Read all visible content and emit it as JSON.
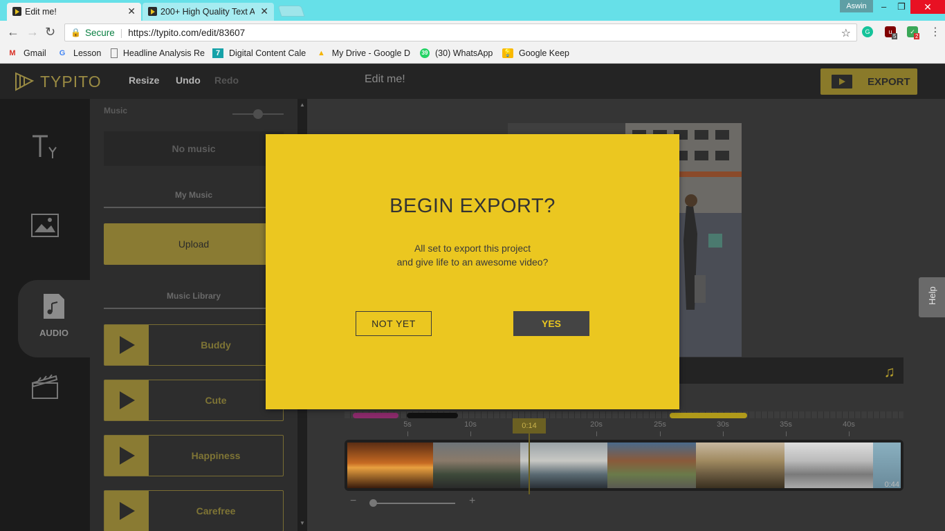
{
  "browser": {
    "tabs": [
      {
        "title": "Edit me!",
        "active": true
      },
      {
        "title": "200+ High Quality Text A",
        "active": false
      }
    ],
    "user": "Aswin",
    "secure_label": "Secure",
    "url": "https://typito.com/edit/83607",
    "ext_badges": {
      "ublock": "5",
      "green": "2"
    },
    "bookmarks": [
      {
        "label": "Gmail",
        "icon": "gmail-icon"
      },
      {
        "label": "Lesson",
        "icon": "google-icon"
      },
      {
        "label": "Headline Analysis Re",
        "icon": "page-icon"
      },
      {
        "label": "Digital Content Cale",
        "icon": "calendar-icon"
      },
      {
        "label": "My Drive - Google D",
        "icon": "drive-icon"
      },
      {
        "label": "(30) WhatsApp",
        "icon": "whatsapp-icon"
      },
      {
        "label": "Google Keep",
        "icon": "keep-icon"
      }
    ]
  },
  "app": {
    "logo": "TYPITO",
    "resize": "Resize",
    "undo": "Undo",
    "redo": "Redo",
    "project_title": "Edit me!",
    "export": "EXPORT",
    "accent": "#ebc720"
  },
  "rail": {
    "active_label": "AUDIO",
    "tabs": [
      "text-icon",
      "image-icon",
      "audio-icon",
      "clapper-icon"
    ]
  },
  "music_panel": {
    "music_label": "Music",
    "no_music": "No music",
    "my_music": "My Music",
    "upload": "Upload",
    "music_library": "Music Library",
    "tracks": [
      "Buddy",
      "Cute",
      "Happiness",
      "Carefree"
    ]
  },
  "timeline": {
    "ticks": [
      "5s",
      "10s",
      "20s",
      "25s",
      "30s",
      "35s",
      "40s"
    ],
    "playhead": "0:14",
    "duration": "0:44"
  },
  "help": "Help",
  "modal": {
    "title": "BEGIN EXPORT?",
    "line1": "All set to export this project",
    "line2": "and give life to an awesome video?",
    "not_yet": "NOT YET",
    "yes": "YES"
  }
}
